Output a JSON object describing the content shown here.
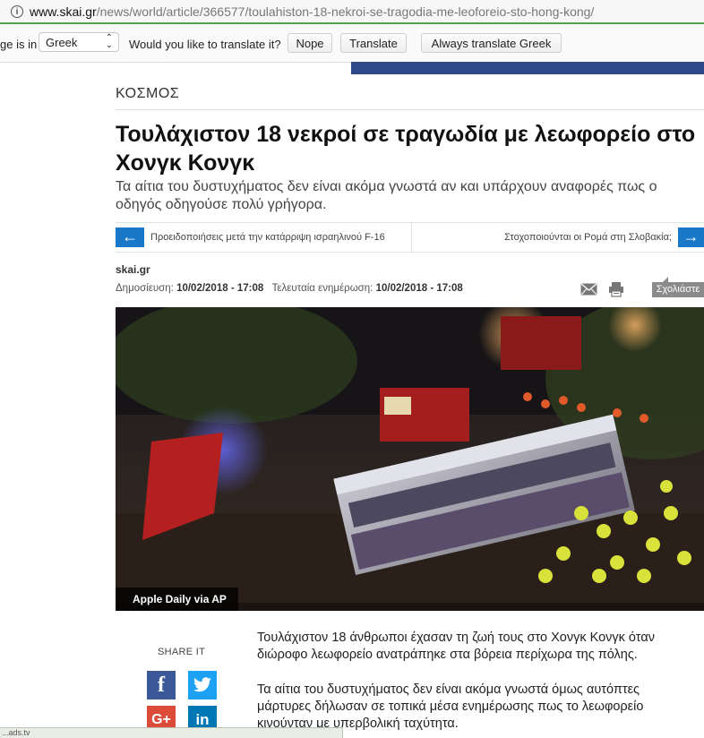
{
  "browser": {
    "url_host": "www.skai.gr",
    "url_path": "/news/world/article/366577/toulahiston-18-nekroi-se-tragodia-me-leoforeio-sto-hong-kong/"
  },
  "translate_bar": {
    "page_is_in": "ge is in",
    "language": "Greek",
    "question": "Would you like to translate it?",
    "nope": "Nope",
    "translate": "Translate",
    "always": "Always translate Greek"
  },
  "article": {
    "section": "ΚΟΣΜΟΣ",
    "title": "Τουλάχιστον 18 νεκροί σε τραγωδία με λεωφορείο στο Χονγκ Κονγκ",
    "subtitle": "Τα αίτια του δυστυχήματος δεν είναι ακόμα γνωστά αν και υπάρχουν αναφορές πως ο οδηγός οδηγούσε πολύ γρήγορα.",
    "prev_title": "Προειδοποιήσεις μετά την κατάρριψη ισραηλινού F-16",
    "next_title": "Στοχοποιούνται οι Ρομά στη Σλοβακία;",
    "source": "skai.gr",
    "published_label": "Δημοσίευση:",
    "published": "10/02/2018 - 17:08",
    "updated_label": "Τελευταία ενημέρωση:",
    "updated": "10/02/2018 - 17:08",
    "comment_label": "Σχολιάστε",
    "photo_credit": "Apple Daily via AP",
    "share_label": "SHARE IT",
    "paragraphs": [
      "Τουλάχιστον 18 άνθρωποι έχασαν τη ζωή τους στο Χονγκ Κονγκ όταν διώροφο λεωφορείο ανατράπηκε στα βόρεια περίχωρα της πόλης.",
      "Τα αίτια του δυστυχήματος δεν είναι ακόμα γνωστά όμως αυτόπτες μάρτυρες δήλωσαν σε τοπικά μέσα ενημέρωσης πως το λεωφορείο κινούνταν με υπερβολική ταχύτητα."
    ]
  },
  "status_bar": "...ads.tv"
}
